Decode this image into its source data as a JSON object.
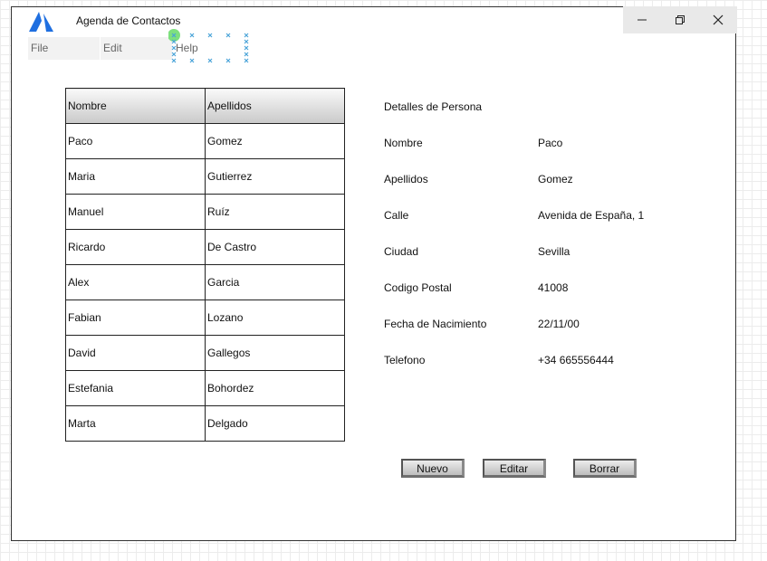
{
  "window": {
    "title": "Agenda de Contactos"
  },
  "menu": {
    "file": "File",
    "edit": "Edit",
    "help": "Help"
  },
  "table": {
    "headers": [
      "Nombre",
      "Apellidos"
    ],
    "rows": [
      [
        "Paco",
        "Gomez"
      ],
      [
        "Maria",
        "Gutierrez"
      ],
      [
        "Manuel",
        "Ruíz"
      ],
      [
        "Ricardo",
        "De Castro"
      ],
      [
        "Alex",
        "Garcia"
      ],
      [
        "Fabian",
        "Lozano"
      ],
      [
        "David",
        "Gallegos"
      ],
      [
        "Estefania",
        "Bohordez"
      ],
      [
        "Marta",
        "Delgado"
      ]
    ]
  },
  "details": {
    "heading": "Detalles de Persona",
    "fields": [
      {
        "label": "Nombre",
        "value": "Paco"
      },
      {
        "label": "Apellidos",
        "value": "Gomez"
      },
      {
        "label": "Calle",
        "value": "Avenida de España, 1"
      },
      {
        "label": "Ciudad",
        "value": "Sevilla"
      },
      {
        "label": "Codigo Postal",
        "value": "41008"
      },
      {
        "label": "Fecha de Nacimiento",
        "value": "22/11/00"
      },
      {
        "label": "Telefono",
        "value": "+34 665556444"
      }
    ]
  },
  "buttons": {
    "new": "Nuevo",
    "edit": "Editar",
    "delete": "Borrar"
  },
  "icons": {
    "logo": "app-logo-icon",
    "minimize": "minimize-icon",
    "restore": "restore-icon",
    "close": "close-icon"
  },
  "colors": {
    "logo": "#1f6fe0",
    "selection_dots": "#4aa3d9",
    "selection_anchor": "#7ee07e"
  }
}
